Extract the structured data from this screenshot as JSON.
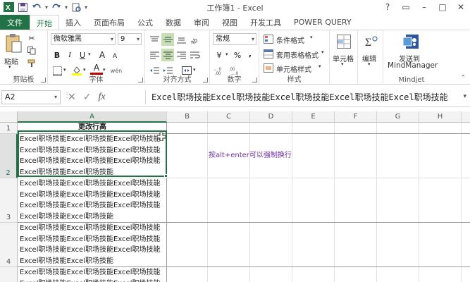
{
  "window": {
    "title": "工作簿1 - Excel",
    "controls": [
      "?",
      "▭",
      "–",
      "□",
      "✕"
    ]
  },
  "ribbon_tabs": [
    "文件",
    "开始",
    "插入",
    "页面布局",
    "公式",
    "数据",
    "审阅",
    "视图",
    "开发工具",
    "POWER QUERY"
  ],
  "active_tab": "开始",
  "ribbon": {
    "clipboard": {
      "paste": "粘贴",
      "label": "剪贴板"
    },
    "font": {
      "name": "微软雅黑",
      "size": "9",
      "bold": "B",
      "italic": "I",
      "underline": "U",
      "grow": "A",
      "shrink": "A",
      "color_label": "A",
      "wen": "wén",
      "label": "字体"
    },
    "alignment": {
      "label": "对齐方式"
    },
    "number": {
      "format": "常规",
      "percent": "%",
      "comma": ",",
      "currency": "¥",
      "label": "数字"
    },
    "styles": {
      "conditional": "条件格式",
      "table": "套用表格格式",
      "cell_styles": "单元格样式",
      "label": "样式"
    },
    "cells": {
      "label": "单元格"
    },
    "editing": {
      "label": "编辑"
    },
    "mindjet": {
      "send_line1": "发送到",
      "send_line2": "MindManager",
      "label": "Mindjet"
    }
  },
  "formula_bar": {
    "name_box": "A2",
    "cancel": "✕",
    "enter": "✓",
    "fx": "fx",
    "content": "Excel职场技能Excel职场技能Excel职场技能Excel职场技能Excel职场技能"
  },
  "columns": [
    "A",
    "B",
    "C",
    "D",
    "E",
    "F",
    "G",
    "H"
  ],
  "rows": [
    "1",
    "2",
    "3",
    "4"
  ],
  "cells": {
    "A1": "更改行高",
    "A2": "Excel职场技能Excel职场技能Excel职场技能\nExcel职场技能Excel职场技能Excel职场技能\nExcel职场技能Excel职场技能Excel职场技能\nExcel职场技能Excel职场技能",
    "A3": "Excel职场技能Excel职场技能Excel职场技能\nExcel职场技能Excel职场技能Excel职场技能\nExcel职场技能Excel职场技能Excel职场技能\nExcel职场技能Excel职场技能",
    "A4": "Excel职场技能Excel职场技能Excel职场技能\nExcel职场技能Excel职场技能Excel职场技能\nExcel职场技能Excel职场技能Excel职场技能\nExcel职场技能Excel职场技能",
    "A5": "Excel职场技能Excel职场技能Excel职场技能\nExcel职场技能Excel职场技能Excel职场技能",
    "C2": "按alt+enter可以强制换行"
  },
  "colors": {
    "accent": "#217346",
    "note": "#7030a0"
  }
}
